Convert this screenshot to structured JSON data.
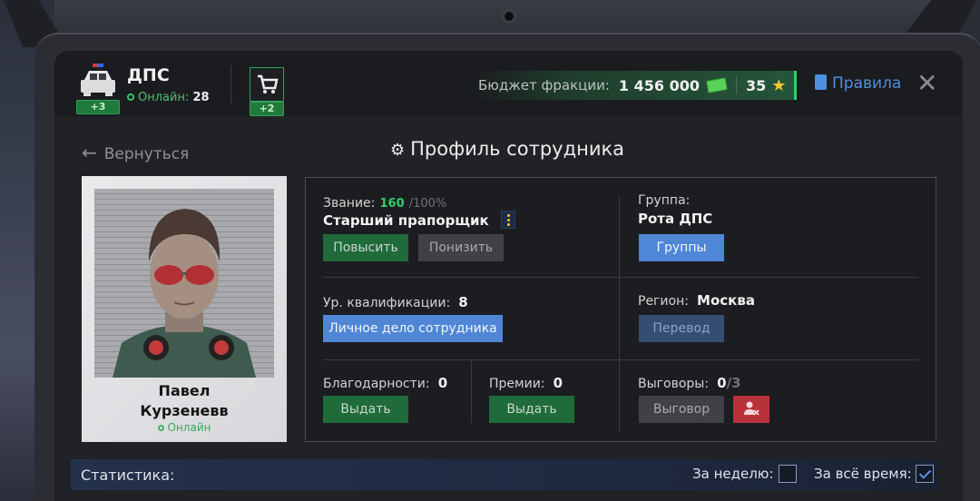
{
  "header": {
    "faction_name": "ДПС",
    "online_label": "Онлайн:",
    "online_count": "28",
    "faction_badge": "+3",
    "cart_badge": "+2",
    "budget_label": "Бюджет фракции:",
    "budget_value": "1 456 000",
    "stars_value": "35",
    "rules_label": "Правила",
    "close_glyph": "✕"
  },
  "nav": {
    "back_label": "Вернуться",
    "page_title": "Профиль сотрудника"
  },
  "employee": {
    "first_name": "Павел",
    "last_name": "Курзеневв",
    "status": "Онлайн"
  },
  "profile": {
    "rank_label": "Звание:",
    "rank_progress": "160",
    "rank_progress_max": "/100%",
    "rank_name": "Старший прапорщик",
    "promote_button": "Повысить",
    "demote_button": "Понизить",
    "group_label": "Группа:",
    "group_name": "Рота ДПС",
    "groups_button": "Группы",
    "qualification_label": "Ур. квалификации:",
    "qualification_value": "8",
    "personal_file_button": "Личное дело сотрудника",
    "region_label": "Регион:",
    "region_name": "Москва",
    "transfer_button": "Перевод",
    "thanks_label": "Благодарности:",
    "thanks_value": "0",
    "thanks_button": "Выдать",
    "bonuses_label": "Премии:",
    "bonuses_value": "0",
    "bonuses_button": "Выдать",
    "reprimands_label": "Выговоры:",
    "reprimands_value": "0",
    "reprimands_max": "/3",
    "reprimand_button": "Выговор"
  },
  "stats": {
    "title": "Статистика:",
    "week_label": "За неделю:",
    "week_checked": false,
    "all_time_label": "За всё время:",
    "all_time_checked": true
  },
  "icons": {
    "faction": "police-car-icon",
    "cart": "cart-icon",
    "money": "money-icon",
    "star": "star-icon",
    "rules": "clipboard-icon",
    "settings": "gear-icon",
    "remove_reprimand": "remove-user-icon"
  },
  "colors": {
    "accent_green": "#2fd16a",
    "accent_blue": "#4f86d6",
    "danger_red": "#b8323a"
  }
}
